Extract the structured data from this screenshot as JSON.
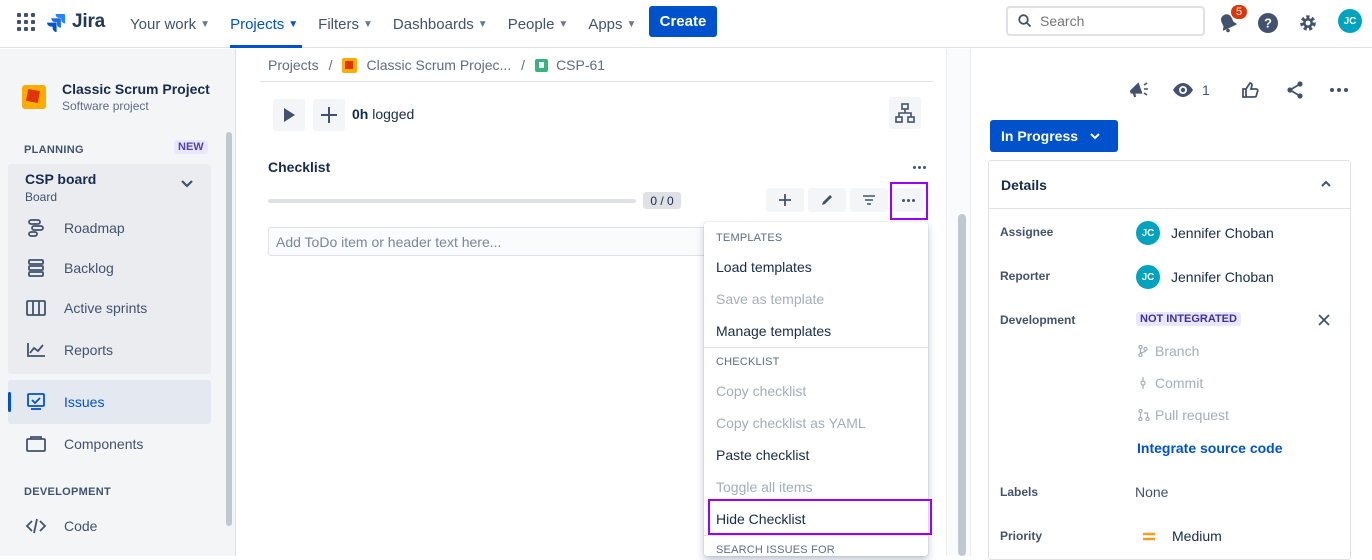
{
  "topbar": {
    "logo_text": "Jira",
    "nav": [
      {
        "label": "Your work"
      },
      {
        "label": "Projects"
      },
      {
        "label": "Filters"
      },
      {
        "label": "Dashboards"
      },
      {
        "label": "People"
      },
      {
        "label": "Apps"
      }
    ],
    "create_label": "Create",
    "search_placeholder": "Search",
    "notification_count": "5",
    "user_initials": "JC"
  },
  "sidebar": {
    "project_name": "Classic Scrum Project",
    "project_type": "Software project",
    "planning_label": "PLANNING",
    "new_badge": "NEW",
    "board_title": "CSP board",
    "board_sub": "Board",
    "items": [
      {
        "label": "Roadmap",
        "icon": "roadmap-icon"
      },
      {
        "label": "Backlog",
        "icon": "backlog-icon"
      },
      {
        "label": "Active sprints",
        "icon": "board-icon"
      },
      {
        "label": "Reports",
        "icon": "reports-icon"
      },
      {
        "label": "Issues",
        "icon": "issues-icon"
      },
      {
        "label": "Components",
        "icon": "components-icon"
      }
    ],
    "development_label": "DEVELOPMENT",
    "code_label": "Code"
  },
  "breadcrumb": {
    "projects": "Projects",
    "project": "Classic Scrum Projec...",
    "issue": "CSP-61",
    "sep": "/"
  },
  "time": {
    "logged_value": "0h",
    "logged_label": "logged"
  },
  "checklist": {
    "title": "Checklist",
    "progress": "0 / 0",
    "placeholder": "Add ToDo item or header text here..."
  },
  "menu": {
    "sec_templates": "TEMPLATES",
    "load_templates": "Load templates",
    "save_as_template": "Save as template",
    "manage_templates": "Manage templates",
    "sec_checklist": "CHECKLIST",
    "copy_checklist": "Copy checklist",
    "copy_yaml": "Copy checklist as YAML",
    "paste_checklist": "Paste checklist",
    "toggle_all": "Toggle all items",
    "hide_checklist": "Hide Checklist",
    "sec_search": "SEARCH ISSUES FOR"
  },
  "right": {
    "watch_count": "1",
    "status": "In Progress",
    "details_title": "Details",
    "assignee_label": "Assignee",
    "assignee": "Jennifer Choban",
    "reporter_label": "Reporter",
    "reporter": "Jennifer Choban",
    "development_label": "Development",
    "not_integrated": "NOT INTEGRATED",
    "branch": "Branch",
    "commit": "Commit",
    "pull_request": "Pull request",
    "integrate": "Integrate source code",
    "labels_label": "Labels",
    "labels_value": "None",
    "priority_label": "Priority",
    "priority_value": "Medium"
  },
  "colors": {
    "brand": "#0052cc",
    "highlight": "#9b00ff",
    "priority_medium": "#ff991f"
  }
}
